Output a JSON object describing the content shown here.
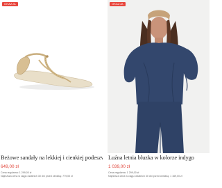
{
  "products": [
    {
      "badge": "OKAZJA",
      "title": "Beżowe sandały na lekkiej i cienkiej podeszwie",
      "price": "649,00 zł",
      "regular_price": "Cena regularna: 1 299,00 zł",
      "lowest_price": "Najniższa cena w ciągu ostatnich 30 dni przed obniżką: 779,00 zł",
      "image": "beige-thong-sandal",
      "colors": {
        "sandal": "#d9c39a",
        "sole": "#e7dcc5"
      }
    },
    {
      "badge": "OKAZJA",
      "title": "Luźna letnia bluzka w kolorze indygo",
      "price": "1 039,00 zł",
      "regular_price": "Cena regularna: 1 299,00 zł",
      "lowest_price": "Najniższa cena w ciągu ostatnich 30 dni przed obniżką: 1 169,00 zł",
      "image": "model-in-indigo-blouse",
      "colors": {
        "outfit": "#33476d",
        "headband": "#c6a27a",
        "hair": "#4a2e20"
      }
    }
  ],
  "accent": "#e0453a"
}
